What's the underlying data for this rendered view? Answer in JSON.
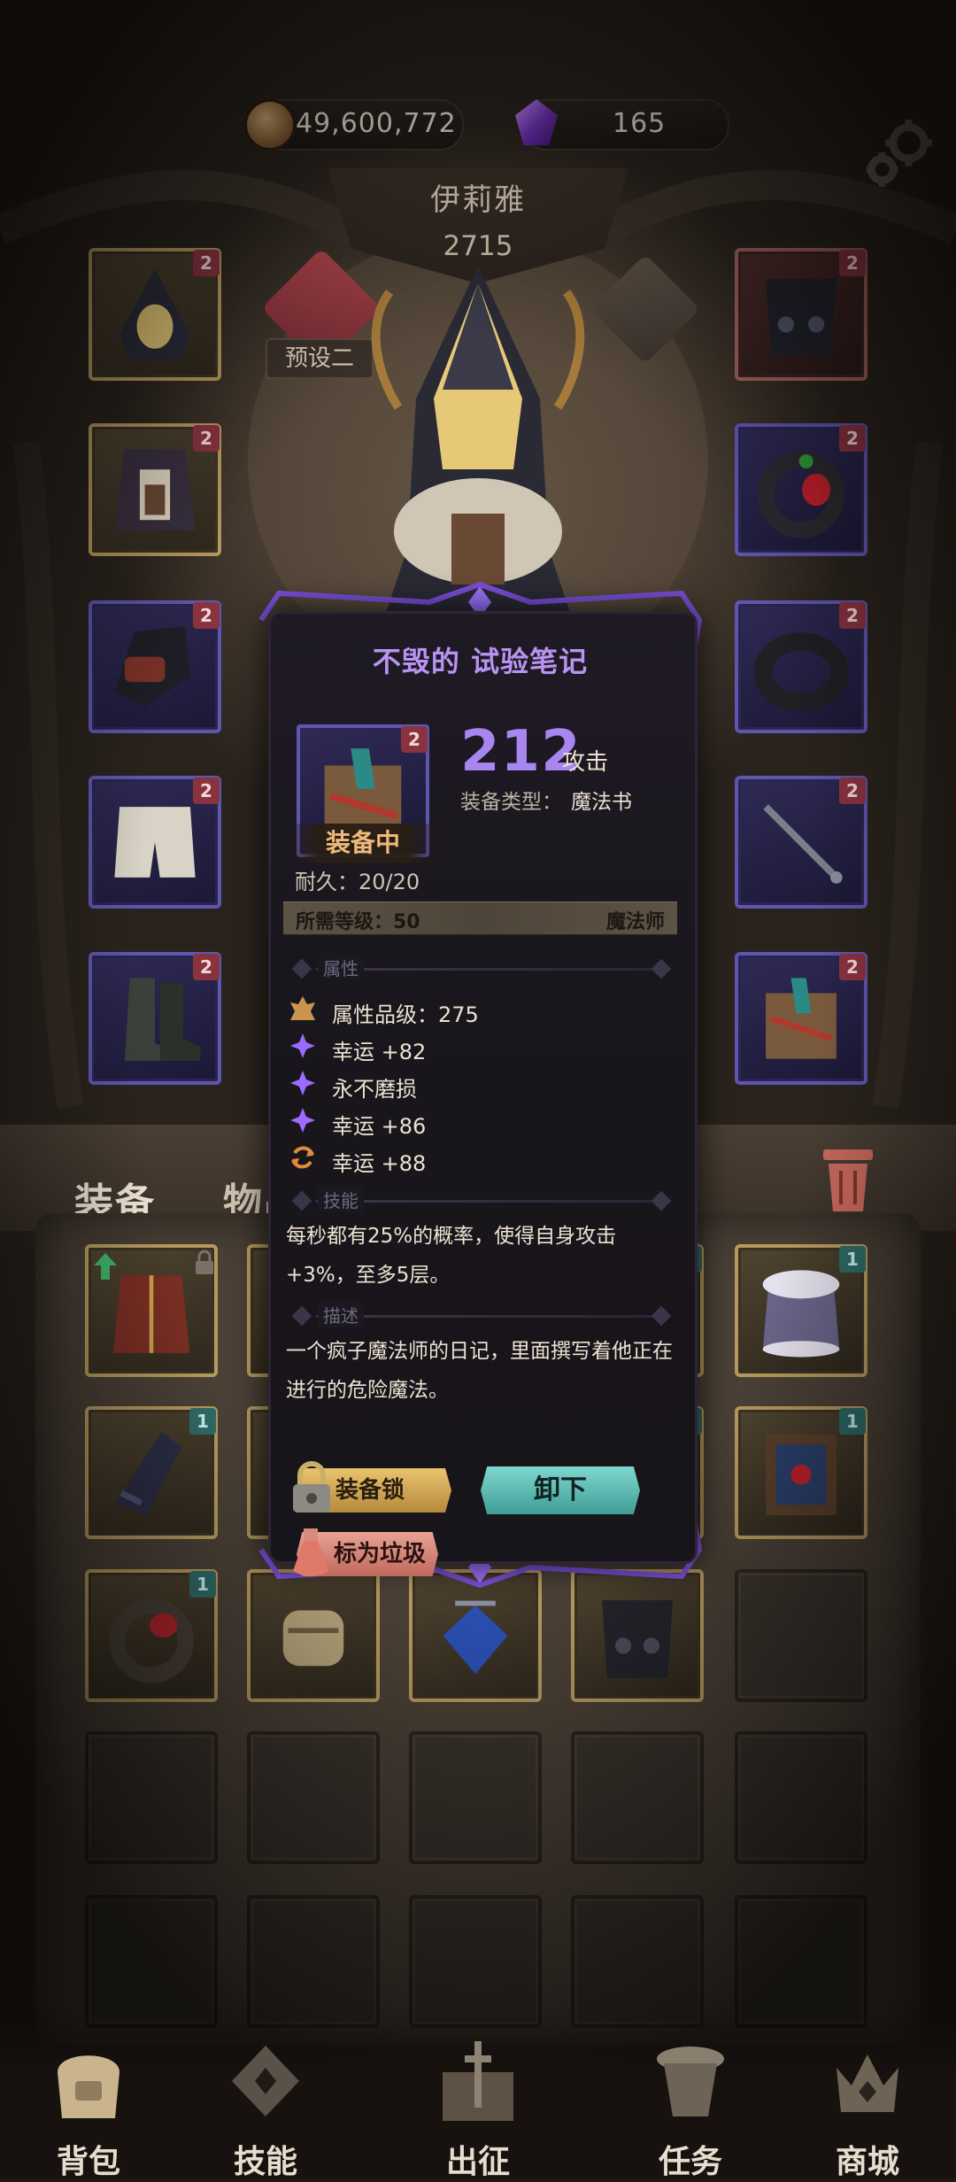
{
  "currencies": {
    "gold": "49,600,772",
    "crystals": "165"
  },
  "hero": {
    "name": "伊莉雅",
    "power": "2715",
    "preset_label": "预设二"
  },
  "equipment_slots": {
    "left": [
      {
        "rank": "2",
        "frame": "gold",
        "item": "hood-icon"
      },
      {
        "rank": "2",
        "frame": "gold",
        "item": "cloak-icon"
      },
      {
        "rank": "2",
        "frame": "purple",
        "item": "gauntlet-icon"
      },
      {
        "rank": "2",
        "frame": "purple",
        "item": "shorts-icon"
      },
      {
        "rank": "2",
        "frame": "purple",
        "item": "boots-icon"
      }
    ],
    "right": [
      {
        "rank": "2",
        "frame": "red",
        "item": "armor-icon"
      },
      {
        "rank": "2",
        "frame": "purple",
        "item": "gem-ring-icon"
      },
      {
        "rank": "2",
        "frame": "purple",
        "item": "dark-ring-icon"
      },
      {
        "rank": "2",
        "frame": "purple",
        "item": "wand-icon"
      },
      {
        "rank": "2",
        "frame": "purple",
        "item": "spellbook-icon"
      }
    ]
  },
  "tabs": {
    "equipment": "装备",
    "items": "物品"
  },
  "inventory": {
    "rows": [
      [
        {
          "frame": "gold",
          "item": "red-robe-icon",
          "badge": "lock",
          "arrow": true
        },
        {
          "frame": "gold",
          "item": "hidden",
          "badge": ""
        },
        {
          "frame": "gold",
          "item": "hidden",
          "badge": ""
        },
        {
          "frame": "gold",
          "item": "hidden",
          "badge": "1"
        },
        {
          "frame": "gold",
          "item": "fur-coat-icon",
          "badge": "1"
        }
      ],
      [
        {
          "frame": "gold",
          "item": "dark-gauntlet-icon",
          "badge": "1"
        },
        {
          "frame": "gold",
          "item": "hidden",
          "badge": ""
        },
        {
          "frame": "gold",
          "item": "hidden",
          "badge": ""
        },
        {
          "frame": "gold",
          "item": "hidden",
          "badge": "1"
        },
        {
          "frame": "gold",
          "item": "ornate-book-icon",
          "badge": "1"
        }
      ],
      [
        {
          "frame": "gold",
          "item": "serpent-ring-icon",
          "badge": "1"
        },
        {
          "frame": "gold",
          "item": "stone-fist-icon",
          "badge": ""
        },
        {
          "frame": "gold",
          "item": "sapphire-amulet-icon",
          "badge": ""
        },
        {
          "frame": "gold",
          "item": "dark-armor-icon",
          "badge": ""
        },
        {
          "frame": "empty",
          "item": "",
          "badge": ""
        }
      ]
    ]
  },
  "popup": {
    "title": "不毁的 试验笔记",
    "rank": "2",
    "equipped_tag": "装备中",
    "attack_value": "212",
    "attack_label": "攻击",
    "equip_type_label": "装备类型：",
    "equip_type_value": "魔法书",
    "durability": "耐久：20/20",
    "required_level": "所需等级：50",
    "required_class": "魔法师",
    "attributes_header": "属性",
    "stats": [
      {
        "icon": "quality-crest-icon",
        "text": "属性品级：275"
      },
      {
        "icon": "purple-star-icon",
        "text": "幸运 +82"
      },
      {
        "icon": "purple-star-icon",
        "text": "永不磨损"
      },
      {
        "icon": "purple-star-icon",
        "text": "幸运 +86"
      },
      {
        "icon": "orange-cycle-icon",
        "text": "幸运 +88"
      }
    ],
    "skill_header": "技能",
    "skill_text": "每秒都有25%的概率，使得自身攻击+3%，至多5层。",
    "description_header": "描述",
    "description_text": "一个疯子魔法师的日记，里面撰写着他正在进行的危险魔法。",
    "lock_button": "装备锁",
    "unequip_button": "卸下",
    "trash_button": "标为垃圾"
  },
  "nav": {
    "bag": "背包",
    "skills": "技能",
    "deploy": "出征",
    "quests": "任务",
    "shop": "商城"
  },
  "colors": {
    "accent_purple": "#a886f0",
    "rank_red": "#8a3340",
    "teal_button": "#7fd7cf",
    "gold_button": "#e9c46d"
  }
}
